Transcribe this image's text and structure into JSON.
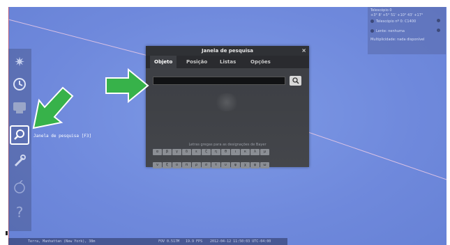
{
  "search_window": {
    "title": "Janela de pesquisa",
    "close_glyph": "×",
    "tabs": [
      "Objeto",
      "Posição",
      "Listas",
      "Opções"
    ],
    "active_tab": "Objeto",
    "search_input_value": "",
    "search_button_icon": "magnifier-icon",
    "greek_hint": "Letras gregas para as designações de Bayer",
    "greek_letters_row1": [
      "α",
      "β",
      "γ",
      "δ",
      "ε",
      "ζ",
      "η",
      "θ",
      "ι",
      "κ",
      "λ",
      "μ"
    ],
    "greek_letters_row2": [
      "ν",
      "ξ",
      "ο",
      "π",
      "ρ",
      "σ",
      "τ",
      "υ",
      "φ",
      "χ",
      "ψ",
      "ω"
    ]
  },
  "toolbar": {
    "tooltip": "Janela de pesquisa  [F3]",
    "icons": [
      "sun-settings-icon",
      "clock-icon",
      "sky-display-icon",
      "search-icon",
      "tools-icon",
      "scope-icon",
      "help-icon"
    ]
  },
  "status_bar": {
    "location": "Terra, Manhattan (New York), 38m",
    "fov": "FOV 0.517M",
    "fps": "19.9 FPS",
    "datetime": "2012-04-12 11:50:03 UTC-04:00"
  },
  "info_panel": {
    "lines": [
      "Telescópio 0",
      "+3° 8' +5° 51' +10° 43' +17°"
    ],
    "telescope": "Telescópio nº 0: C1400",
    "lens": "Lente: nenhuma",
    "multiplicity": "Multiplicidade: nada disponível"
  },
  "colors": {
    "sky": "#7089dc",
    "window_bg": "#3f4146",
    "arrow": "#37b24a"
  }
}
